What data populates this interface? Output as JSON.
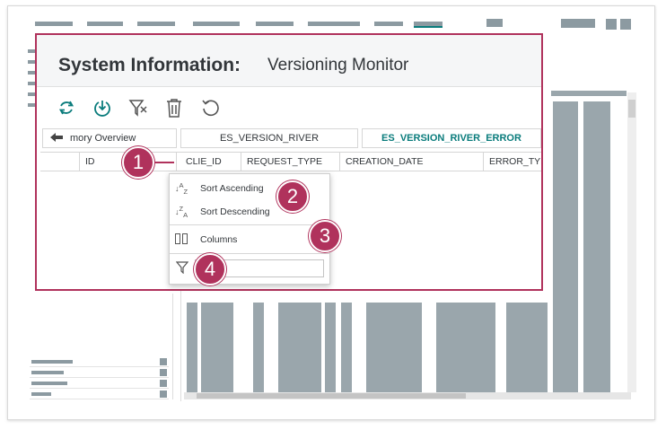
{
  "dialog": {
    "title": "System Information:",
    "subtitle": "Versioning Monitor"
  },
  "toolbar": {
    "icons": [
      "refresh-icon",
      "download-icon",
      "clear-filter-icon",
      "delete-icon",
      "undo-icon"
    ]
  },
  "tabs": [
    {
      "label": "mory Overview",
      "active": false
    },
    {
      "label": "ES_VERSION_RIVER",
      "active": false
    },
    {
      "label": "ES_VERSION_RIVER_ERROR",
      "active": true
    }
  ],
  "columns": [
    "ID",
    "CLIE_ID",
    "REQUEST_TYPE",
    "CREATION_DATE",
    "ERROR_TYPE"
  ],
  "menu": {
    "sort_ascending": "Sort Ascending",
    "sort_descending": "Sort Descending",
    "columns": "Columns",
    "filter_value": ""
  },
  "callouts": [
    "1",
    "2",
    "3",
    "4"
  ],
  "colors": {
    "accent": "#b0325c",
    "active_tab": "#0a7c7c",
    "background_bars": "#9aa6ac"
  }
}
